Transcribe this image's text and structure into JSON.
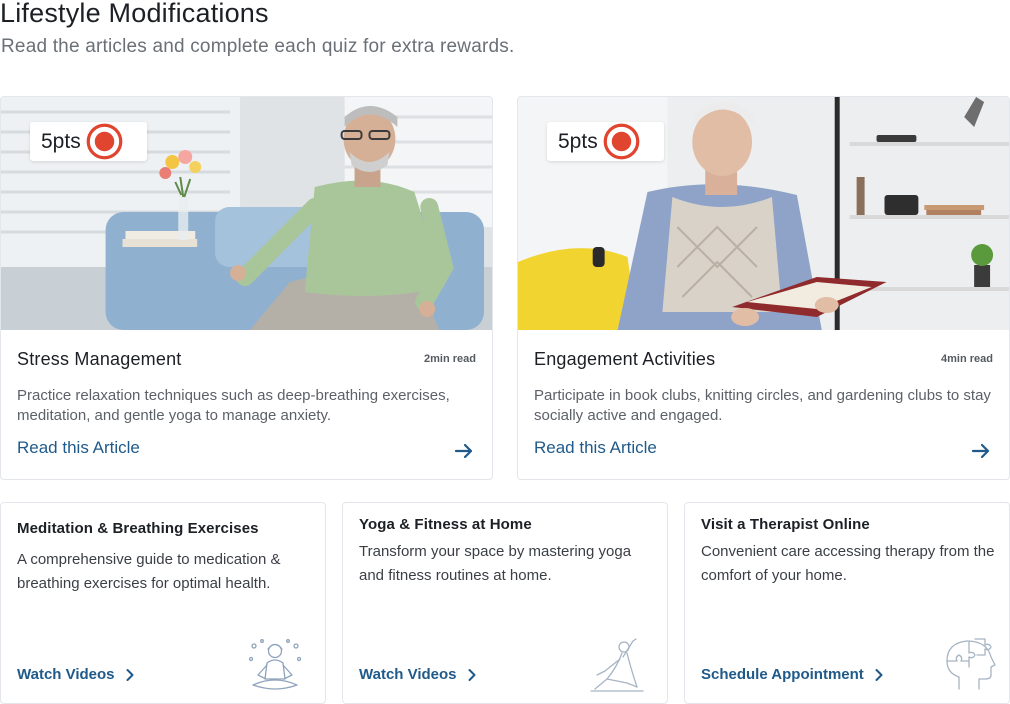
{
  "header": {
    "title": "Lifestyle Modifications",
    "subtitle": "Read the articles and complete each quiz for extra rewards."
  },
  "articles": [
    {
      "points": "5pts",
      "title": "Stress Management",
      "read_time": "2min read",
      "description": "Practice relaxation techniques such as deep-breathing exercises, meditation, and gentle yoga to manage anxiety.",
      "link": "Read this Article"
    },
    {
      "points": "5pts",
      "title": "Engagement Activities",
      "read_time": "4min read",
      "description": "Participate in book clubs, knitting circles, and gardening clubs to stay socially active and engaged.",
      "link": "Read this Article"
    }
  ],
  "resources": [
    {
      "title": "Meditation & Breathing Exercises",
      "description": "A comprehensive guide to medication & breathing exercises for optimal health.",
      "link": "Watch Videos",
      "icon": "meditation-icon"
    },
    {
      "title": "Yoga & Fitness at Home",
      "description": "Transform your space by mastering yoga and fitness routines at home.",
      "link": "Watch Videos",
      "icon": "yoga-icon"
    },
    {
      "title": "Visit a Therapist Online",
      "description": "Convenient care accessing therapy from the comfort of your home.",
      "link": "Schedule Appointment",
      "icon": "puzzle-head-icon"
    }
  ],
  "colors": {
    "link": "#1f5a8a",
    "points_icon": "#e0452f"
  }
}
